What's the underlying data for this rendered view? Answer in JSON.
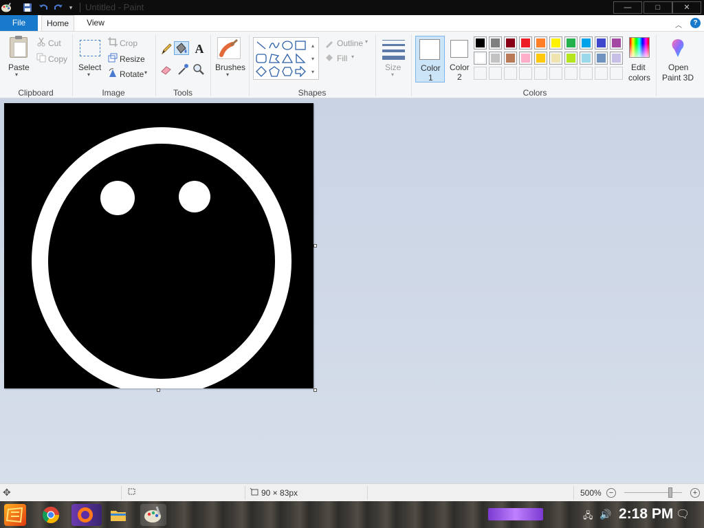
{
  "window": {
    "title": "Untitled - Paint",
    "min_label": "—",
    "max_label": "□",
    "close_label": "✕"
  },
  "tabs": {
    "file": "File",
    "home": "Home",
    "view": "View",
    "help": "?"
  },
  "ribbon": {
    "clipboard": {
      "paste": "Paste",
      "cut": "Cut",
      "copy": "Copy",
      "group": "Clipboard"
    },
    "image": {
      "select": "Select",
      "crop": "Crop",
      "resize": "Resize",
      "rotate": "Rotate",
      "group": "Image"
    },
    "tools": {
      "group": "Tools",
      "text_tool": "A"
    },
    "brushes": "Brushes",
    "shapes": {
      "outline": "Outline",
      "fill": "Fill",
      "group": "Shapes"
    },
    "size": "Size",
    "colors": {
      "color1_line1": "Color",
      "color1_line2": "1",
      "color2_line1": "Color",
      "color2_line2": "2",
      "edit_line1": "Edit",
      "edit_line2": "colors",
      "group": "Colors",
      "color1_value": "#ffffff",
      "color2_value": "#ffffff",
      "palette_row1": [
        "#000000",
        "#7f7f7f",
        "#880015",
        "#ed1c24",
        "#ff7f27",
        "#fff200",
        "#22b14c",
        "#00a2e8",
        "#3f48cc",
        "#a349a4"
      ],
      "palette_row2": [
        "#ffffff",
        "#c3c3c3",
        "#b97a57",
        "#ffaec9",
        "#ffc90e",
        "#efe4b0",
        "#b5e61d",
        "#99d9ea",
        "#7092be",
        "#c8bfe7"
      ]
    },
    "paint3d": {
      "line1": "Open",
      "line2": "Paint 3D"
    }
  },
  "canvas": {
    "background": "#000000",
    "drawing_color": "#ffffff",
    "content": "smiley-face-pixel-art"
  },
  "status": {
    "dimensions": "90 × 83px",
    "zoom": "500%",
    "zoom_level_fraction": 0.8
  },
  "taskbar": {
    "time": "2:18 PM"
  }
}
